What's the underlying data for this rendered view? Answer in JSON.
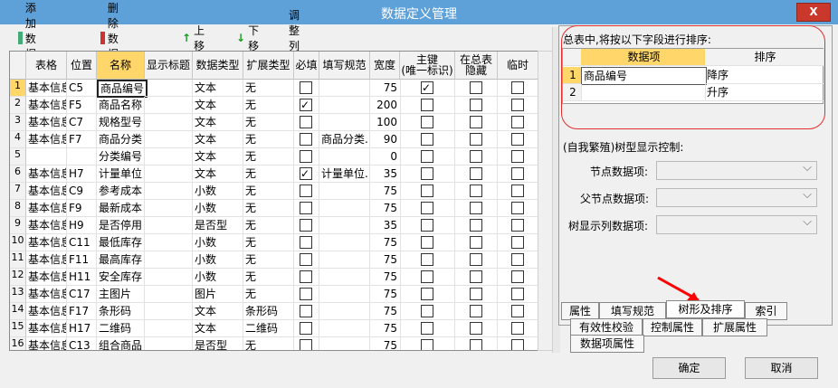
{
  "window": {
    "title": "数据定义管理",
    "close": "X"
  },
  "toolbar": {
    "add": "添加数据项",
    "delete": "删除数据项",
    "up": "上移",
    "down": "下移",
    "adjust": "调整列宽"
  },
  "grid": {
    "headers": [
      "表格",
      "位置",
      "名称",
      "显示标题",
      "数据类型",
      "扩展类型",
      "必填",
      "填写规范",
      "宽度",
      "主键\n(唯一标识)",
      "在总表\n隐藏",
      "临时"
    ],
    "rows": [
      {
        "no": "1",
        "table": "基本信息",
        "pos": "C5",
        "name": "商品编号",
        "title": "",
        "type": "文本",
        "ext": "无",
        "required": false,
        "rule": "",
        "width": "75",
        "pk": true,
        "hidden": false,
        "temp": false
      },
      {
        "no": "2",
        "table": "基本信息",
        "pos": "F5",
        "name": "商品名称",
        "title": "",
        "type": "文本",
        "ext": "无",
        "required": true,
        "rule": "",
        "width": "200",
        "pk": false,
        "hidden": false,
        "temp": false
      },
      {
        "no": "3",
        "table": "基本信息",
        "pos": "C7",
        "name": "规格型号",
        "title": "",
        "type": "文本",
        "ext": "无",
        "required": false,
        "rule": "",
        "width": "100",
        "pk": false,
        "hidden": false,
        "temp": false
      },
      {
        "no": "4",
        "table": "基本信息",
        "pos": "F7",
        "name": "商品分类",
        "title": "",
        "type": "文本",
        "ext": "无",
        "required": false,
        "rule": "商品分类.",
        "width": "90",
        "pk": false,
        "hidden": false,
        "temp": false
      },
      {
        "no": "5",
        "table": "",
        "pos": "",
        "name": "分类编号",
        "title": "",
        "type": "文本",
        "ext": "无",
        "required": false,
        "rule": "",
        "width": "0",
        "pk": false,
        "hidden": false,
        "temp": false
      },
      {
        "no": "6",
        "table": "基本信息",
        "pos": "H7",
        "name": "计量单位",
        "title": "",
        "type": "文本",
        "ext": "无",
        "required": true,
        "rule": "计量单位.",
        "width": "35",
        "pk": false,
        "hidden": false,
        "temp": false
      },
      {
        "no": "7",
        "table": "基本信息",
        "pos": "C9",
        "name": "参考成本",
        "title": "",
        "type": "小数",
        "ext": "无",
        "required": false,
        "rule": "",
        "width": "75",
        "pk": false,
        "hidden": false,
        "temp": false
      },
      {
        "no": "8",
        "table": "基本信息",
        "pos": "F9",
        "name": "最新成本",
        "title": "",
        "type": "小数",
        "ext": "无",
        "required": false,
        "rule": "",
        "width": "75",
        "pk": false,
        "hidden": false,
        "temp": false
      },
      {
        "no": "9",
        "table": "基本信息",
        "pos": "H9",
        "name": "是否停用",
        "title": "",
        "type": "是否型",
        "ext": "无",
        "required": false,
        "rule": "",
        "width": "35",
        "pk": false,
        "hidden": false,
        "temp": false
      },
      {
        "no": "10",
        "table": "基本信息",
        "pos": "C11",
        "name": "最低库存",
        "title": "",
        "type": "小数",
        "ext": "无",
        "required": false,
        "rule": "",
        "width": "75",
        "pk": false,
        "hidden": false,
        "temp": false
      },
      {
        "no": "11",
        "table": "基本信息",
        "pos": "F11",
        "name": "最高库存",
        "title": "",
        "type": "小数",
        "ext": "无",
        "required": false,
        "rule": "",
        "width": "75",
        "pk": false,
        "hidden": false,
        "temp": false
      },
      {
        "no": "12",
        "table": "基本信息",
        "pos": "H11",
        "name": "安全库存",
        "title": "",
        "type": "小数",
        "ext": "无",
        "required": false,
        "rule": "",
        "width": "75",
        "pk": false,
        "hidden": false,
        "temp": false
      },
      {
        "no": "13",
        "table": "基本信息",
        "pos": "C17",
        "name": "主图片",
        "title": "",
        "type": "图片",
        "ext": "无",
        "required": false,
        "rule": "",
        "width": "75",
        "pk": false,
        "hidden": false,
        "temp": false
      },
      {
        "no": "14",
        "table": "基本信息",
        "pos": "F17",
        "name": "条形码",
        "title": "",
        "type": "文本",
        "ext": "条形码",
        "required": false,
        "rule": "",
        "width": "75",
        "pk": false,
        "hidden": false,
        "temp": false
      },
      {
        "no": "15",
        "table": "基本信息",
        "pos": "H17",
        "name": "二维码",
        "title": "",
        "type": "文本",
        "ext": "二维码",
        "required": false,
        "rule": "",
        "width": "75",
        "pk": false,
        "hidden": false,
        "temp": false
      },
      {
        "no": "16",
        "table": "基本信息",
        "pos": "C13",
        "name": "组合商品",
        "title": "",
        "type": "是否型",
        "ext": "无",
        "required": false,
        "rule": "",
        "width": "75",
        "pk": false,
        "hidden": false,
        "temp": false
      }
    ]
  },
  "sort": {
    "header": "总表中,将按以下字段进行排序:",
    "col_item": "数据项",
    "col_order": "排序",
    "rows": [
      {
        "no": "1",
        "item": "商品编号",
        "order": "降序"
      },
      {
        "no": "2",
        "item": "",
        "order": "升序"
      }
    ]
  },
  "tree": {
    "header": "(自我繁殖)树型显示控制:",
    "node_label": "节点数据项:",
    "parent_label": "父节点数据项:",
    "display_label": "树显示列数据项:"
  },
  "tabs": {
    "row1": [
      "属性",
      "填写规范",
      "树形及排序",
      "索引"
    ],
    "row2": [
      "有效性校验",
      "控制属性",
      "扩展属性"
    ],
    "row3": [
      "数据项属性"
    ]
  },
  "buttons": {
    "ok": "确定",
    "cancel": "取消"
  },
  "colors": {
    "title": "#5ea0d8",
    "close": "#c9382b",
    "selected_header": "#ffd66a",
    "arrow": "#ff0000"
  }
}
